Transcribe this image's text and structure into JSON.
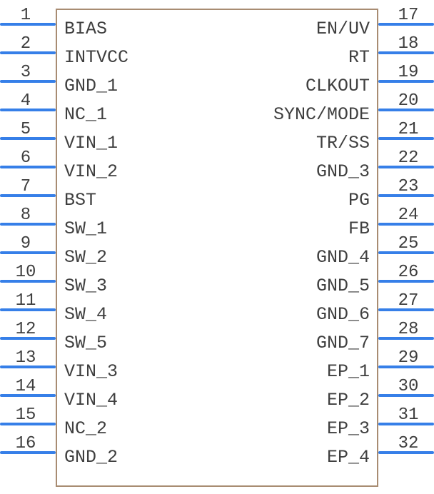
{
  "chip": {
    "left_pins": [
      {
        "num": "1",
        "signal": "BIAS"
      },
      {
        "num": "2",
        "signal": "INTVCC"
      },
      {
        "num": "3",
        "signal": "GND_1"
      },
      {
        "num": "4",
        "signal": "NC_1"
      },
      {
        "num": "5",
        "signal": "VIN_1"
      },
      {
        "num": "6",
        "signal": "VIN_2"
      },
      {
        "num": "7",
        "signal": "BST"
      },
      {
        "num": "8",
        "signal": "SW_1"
      },
      {
        "num": "9",
        "signal": "SW_2"
      },
      {
        "num": "10",
        "signal": "SW_3"
      },
      {
        "num": "11",
        "signal": "SW_4"
      },
      {
        "num": "12",
        "signal": "SW_5"
      },
      {
        "num": "13",
        "signal": "VIN_3"
      },
      {
        "num": "14",
        "signal": "VIN_4"
      },
      {
        "num": "15",
        "signal": "NC_2"
      },
      {
        "num": "16",
        "signal": "GND_2"
      }
    ],
    "right_pins": [
      {
        "num": "17",
        "signal": "EN/UV"
      },
      {
        "num": "18",
        "signal": "RT"
      },
      {
        "num": "19",
        "signal": "CLKOUT"
      },
      {
        "num": "20",
        "signal": "SYNC/MODE"
      },
      {
        "num": "21",
        "signal": "TR/SS"
      },
      {
        "num": "22",
        "signal": "GND_3"
      },
      {
        "num": "23",
        "signal": "PG"
      },
      {
        "num": "24",
        "signal": "FB"
      },
      {
        "num": "25",
        "signal": "GND_4"
      },
      {
        "num": "26",
        "signal": "GND_5"
      },
      {
        "num": "27",
        "signal": "GND_6"
      },
      {
        "num": "28",
        "signal": "GND_7"
      },
      {
        "num": "29",
        "signal": "EP_1"
      },
      {
        "num": "30",
        "signal": "EP_2"
      },
      {
        "num": "31",
        "signal": "EP_3"
      },
      {
        "num": "32",
        "signal": "EP_4"
      }
    ]
  }
}
